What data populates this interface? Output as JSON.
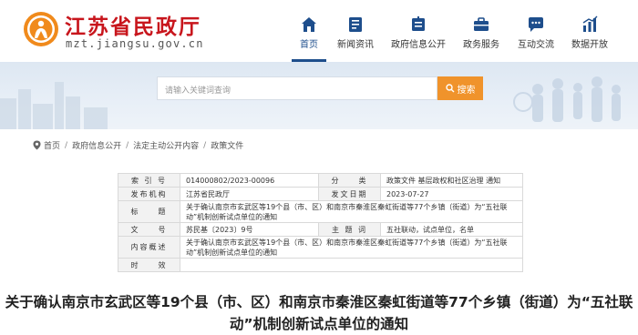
{
  "site": {
    "name": "江苏省民政厅",
    "url": "mzt.jiangsu.gov.cn"
  },
  "nav": {
    "items": [
      {
        "label": "首页",
        "icon": "home-icon",
        "active": true
      },
      {
        "label": "新闻资讯",
        "icon": "news-icon",
        "active": false
      },
      {
        "label": "政府信息公开",
        "icon": "info-disclosure-icon",
        "active": false
      },
      {
        "label": "政务服务",
        "icon": "service-icon",
        "active": false
      },
      {
        "label": "互动交流",
        "icon": "chat-icon",
        "active": false
      },
      {
        "label": "数据开放",
        "icon": "chart-icon",
        "active": false
      }
    ]
  },
  "search": {
    "placeholder": "请输入关键词查询",
    "button_label": "搜索"
  },
  "breadcrumb": [
    "首页",
    "政府信息公开",
    "法定主动公开内容",
    "政策文件"
  ],
  "meta": {
    "index_label": "索 引 号",
    "index_value": "014000802/2023-00096",
    "category_label": "分　　类",
    "category_value": "政策文件 基层政权和社区治理 通知",
    "issuer_label": "发布机构",
    "issuer_value": "江苏省民政厅",
    "date_label": "发文日期",
    "date_value": "2023-07-27",
    "title_label": "标　　题",
    "title_value": "关于确认南京市玄武区等19个县（市、区）和南京市秦淮区秦虹街道等77个乡镇（街道）为“五社联动”机制创新试点单位的通知",
    "docno_label": "文　　号",
    "docno_value": "苏民基〔2023〕9号",
    "keywords_label": "主 题 词",
    "keywords_value": "五社联动，试点单位，名单",
    "summary_label": "内容概述",
    "summary_value": "关于确认南京市玄武区等19个县（市、区）和南京市秦淮区秦虹街道等77个乡镇（街道）为“五社联动”机制创新试点单位的通知",
    "validity_label": "时　　效",
    "validity_value": ""
  },
  "article": {
    "title": "关于确认南京市玄武区等19个县（市、区）和南京市秦淮区秦虹街道等77个乡镇（街道）为“五社联动”机制创新试点单位的通知"
  },
  "colors": {
    "brand_red": "#c8161d",
    "nav_blue": "#1e4e8c",
    "search_orange": "#f0932b"
  }
}
